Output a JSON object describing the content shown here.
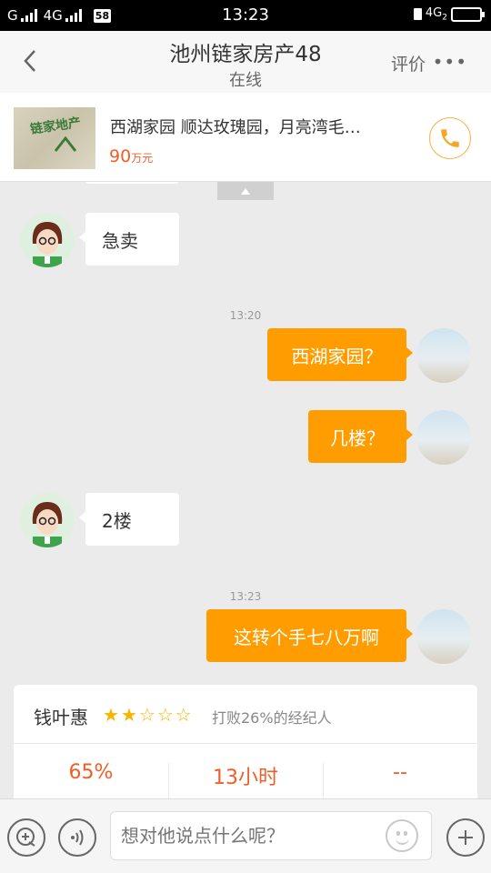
{
  "status_bar": {
    "carrier_left": "G",
    "network": "4G",
    "badge": "58",
    "time": "13:23",
    "network_right": "4G",
    "network_right_sub": "2"
  },
  "nav": {
    "title": "池州链家房产48",
    "subtitle": "在线",
    "rate_label": "评价",
    "more_label": "•••",
    "back_icon": "chevron-left-icon"
  },
  "listing": {
    "title": "西湖家园 顺达玫瑰园，月亮湾毛…",
    "price": "90",
    "price_unit": "万元",
    "thumb_text": "链家地产",
    "call_icon": "phone-icon",
    "accent": "#f25d26"
  },
  "chat": {
    "messages": [
      {
        "from": "agent",
        "text": "急卖"
      },
      {
        "time": "13:20"
      },
      {
        "from": "me",
        "text": "西湖家园？"
      },
      {
        "from": "me",
        "text": "几楼？"
      },
      {
        "from": "agent",
        "text": "2楼"
      },
      {
        "time": "13:23"
      },
      {
        "from": "me",
        "text": "这转个手七八万啊"
      }
    ],
    "bubble_out_color": "#ff9d00"
  },
  "agent_card": {
    "name": "钱叶惠",
    "rating_stars": 2,
    "rating_max": 5,
    "beat_text": "打败26%的经纪人",
    "stats": [
      "65%",
      "13小时",
      "--"
    ]
  },
  "input_bar": {
    "placeholder": "想对他说点什么呢？",
    "left_icon": "chat-plus-icon",
    "voice_icon": "voice-icon",
    "emoji_icon": "smiley-icon",
    "add_icon": "plus-icon"
  }
}
